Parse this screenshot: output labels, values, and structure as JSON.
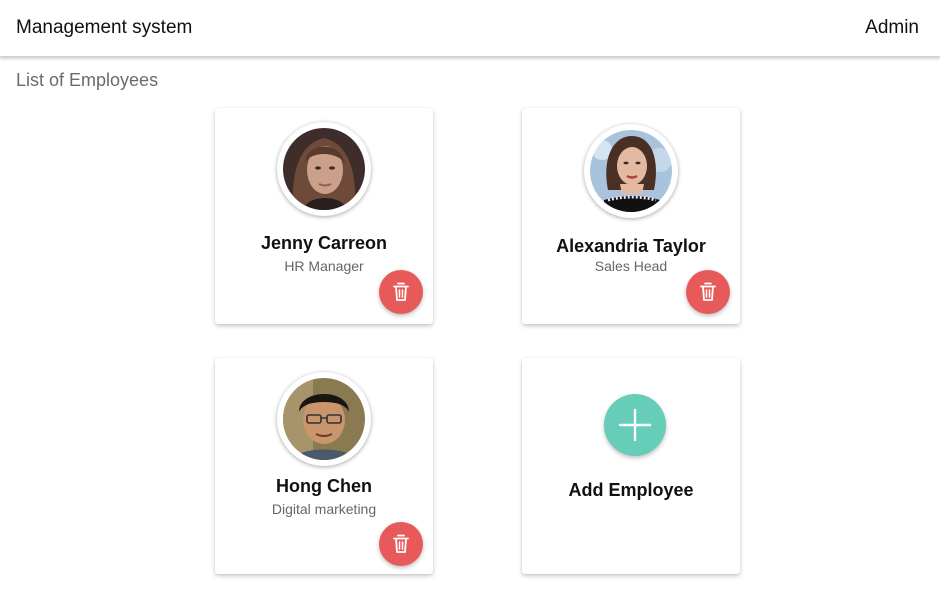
{
  "header": {
    "title": "Management system",
    "user": "Admin"
  },
  "page": {
    "heading": "List of Employees"
  },
  "employees": [
    {
      "name": "Jenny Carreon",
      "role": "HR Manager",
      "avatar": "portrait-photo"
    },
    {
      "name": "Alexandria Taylor",
      "role": "Sales Head",
      "avatar": "portrait-photo"
    },
    {
      "name": "Hong Chen",
      "role": "Digital marketing",
      "avatar": "portrait-photo"
    }
  ],
  "add_card": {
    "label": "Add Employee",
    "icon": "plus-icon"
  },
  "icons": {
    "delete": "trash-icon",
    "add": "plus-icon"
  },
  "colors": {
    "delete_button": "#e85a5a",
    "add_button": "#66cdb8",
    "heading_text": "#6b6b6b",
    "role_text": "#666666"
  }
}
